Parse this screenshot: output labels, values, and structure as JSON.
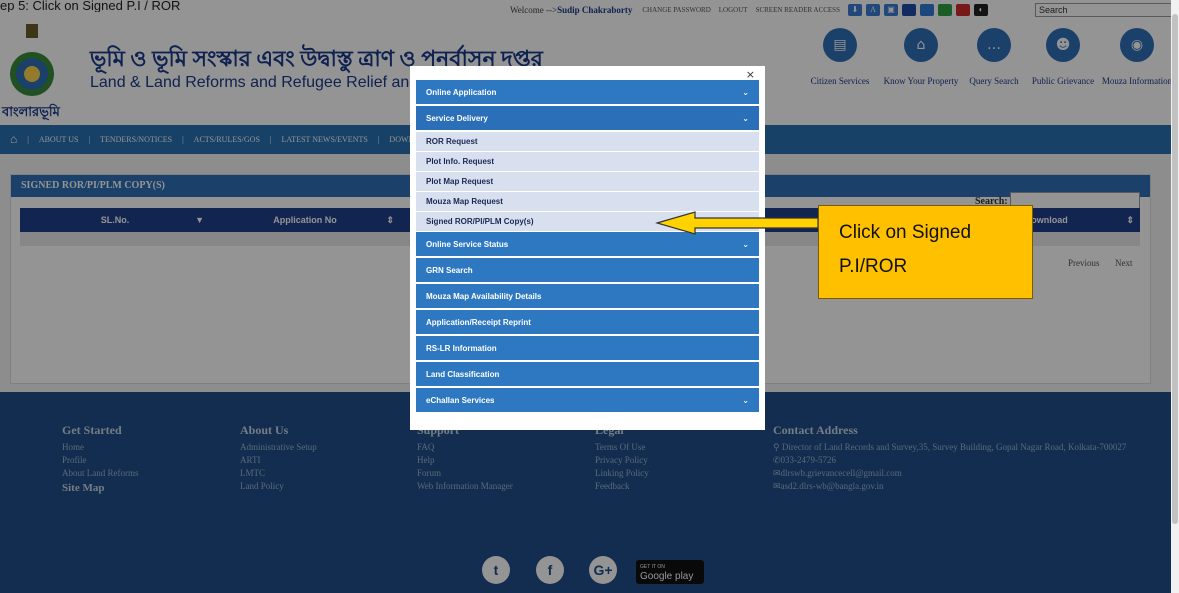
{
  "caption": "ep 5: Click on Signed P.I / ROR",
  "topbar": {
    "welcome": "Welcome --> ",
    "user": "Sudip Chakraborty",
    "change_password": "CHANGE PASSWORD",
    "logout": "LOGOUT",
    "screen_reader": "SCREEN READER ACCESS",
    "search_select": "Search"
  },
  "header": {
    "logo_text": "বাংলারভূমি",
    "title_bn": "ভূমি ও ভূমি সংস্কার এবং উদ্বাস্তু ত্রাণ ও পুনর্বাসন দপ্তর",
    "title_en": "Land & Land Reforms and Refugee Relief and Rehabilitation D",
    "services": [
      {
        "label": "Citizen Services",
        "icon": "id-card-icon"
      },
      {
        "label": "Know Your Property",
        "icon": "home-icon"
      },
      {
        "label": "Query Search",
        "icon": "chat-icon"
      },
      {
        "label": "Public Grievance",
        "icon": "users-icon"
      },
      {
        "label": "Mouza Information",
        "icon": "info-icon"
      }
    ]
  },
  "nav": {
    "about": "ABOUT US",
    "tenders": "TENDERS/NOTICES",
    "acts": "ACTS/RULES/GOS",
    "news": "LATEST NEWS/EVENTS",
    "downloads": "DOWNL"
  },
  "table": {
    "title": "SIGNED ROR/PI/PLM COPY(S)",
    "search_label": "Search:",
    "col_sl": "SL.No.",
    "col_app": "Application No",
    "col_download": "/Download",
    "previous": "Previous",
    "next": "Next"
  },
  "popup": {
    "close": "×",
    "online_application": "Online Application",
    "service_delivery": "Service Delivery",
    "sub_items": [
      "ROR Request",
      "Plot Info. Request",
      "Plot Map Request",
      "Mouza Map Request",
      "Signed ROR/PI/PLM Copy(s)"
    ],
    "online_service_status": "Online Service Status",
    "grn_search": "GRN Search",
    "mouza_map_availability": "Mouza Map Availability Details",
    "reprint": "Application/Receipt Reprint",
    "rslr": "RS-LR Information",
    "land_classification": "Land Classification",
    "echallan": "eChallan Services"
  },
  "callout": {
    "line1": "Click on Signed",
    "line2": "P.I/ROR",
    "color": "#ffc000"
  },
  "footer": {
    "get_started": {
      "title": "Get Started",
      "items": [
        "Home",
        "Profile",
        "About Land Reforms"
      ],
      "site_map": "Site Map"
    },
    "about_us": {
      "title": "About Us",
      "items": [
        "Administrative Setup",
        "ARTI",
        "LMTC",
        "Land Policy"
      ]
    },
    "support": {
      "title": "Support",
      "items": [
        "FAQ",
        "Help",
        "Forum",
        "Web Information Manager"
      ]
    },
    "legal": {
      "title": "Legal",
      "items": [
        "Terms Of Use",
        "Privacy Policy",
        "Linking Policy",
        "Feedback"
      ]
    },
    "contact": {
      "title": "Contact Address",
      "address": "Director of Land Records and Survey,35, Survey Building, Gopal Nagar Road, Kolkata-700027",
      "phone": "033-2479-5726",
      "email1": "dlrswb.grievancecell@gmail.com",
      "email2": "asd2.dlrs-wb@bangla.gov.in"
    },
    "gplay_small": "GET IT ON",
    "gplay_big": "Google play"
  }
}
